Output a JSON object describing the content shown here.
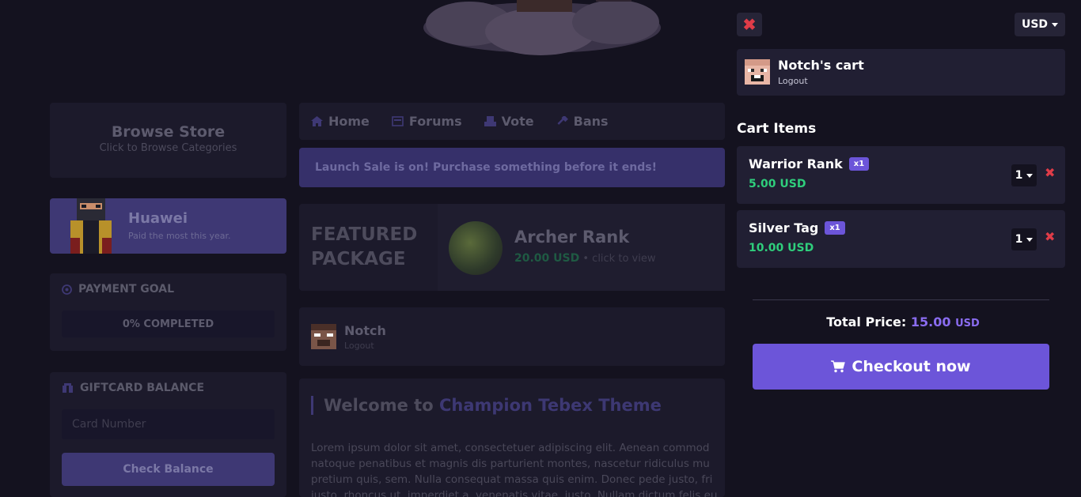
{
  "background": {
    "browse": {
      "title": "Browse Store",
      "subtitle": "Click to Browse Categories"
    },
    "top_donor": {
      "name": "Huawei",
      "subtitle": "Paid the most this year."
    },
    "payment_goal": {
      "title": "PAYMENT GOAL",
      "progress_label": "0% COMPLETED",
      "progress_percent": 0
    },
    "giftcard": {
      "title": "GIFTCARD BALANCE",
      "placeholder": "Card Number",
      "button": "Check Balance"
    },
    "nav": [
      {
        "label": "Home",
        "icon": "home-icon"
      },
      {
        "label": "Forums",
        "icon": "forums-icon"
      },
      {
        "label": "Vote",
        "icon": "vote-icon"
      },
      {
        "label": "Bans",
        "icon": "bans-icon"
      }
    ],
    "sale_banner": "Launch Sale is on! Purchase something before it ends!",
    "featured": {
      "label_line1": "FEATURED",
      "label_line2": "PACKAGE",
      "name": "Archer Rank",
      "price": "20.00 USD",
      "view_text": " • click to view"
    },
    "user": {
      "name": "Notch",
      "logout": "Logout"
    },
    "welcome": {
      "title_prefix": "Welcome to ",
      "title_accent": "Champion Tebex Theme",
      "lines": [
        "Lorem ipsum dolor sit amet, consectetuer adipiscing elit. Aenean commod",
        "natoque penatibus et magnis dis parturient montes, nascetur ridiculus mu",
        "pretium quis, sem. Nulla consequat massa quis enim. Donec pede justo, fri",
        "justo, rhoncus ut, imperdiet a, venenatis vitae, justo. Nullam dictum felis eu"
      ]
    }
  },
  "cart": {
    "currency": "USD",
    "user": {
      "name": "Notch's cart",
      "logout": "Logout"
    },
    "heading": "Cart Items",
    "items": [
      {
        "name": "Warrior Rank",
        "badge": "x1",
        "price": "5.00 USD",
        "quantity": "1"
      },
      {
        "name": "Silver Tag",
        "badge": "x1",
        "price": "10.00 USD",
        "quantity": "1"
      }
    ],
    "total_label": "Total Price:",
    "total_amount": "15.00",
    "total_currency": "USD",
    "checkout_label": "Checkout now"
  },
  "colors": {
    "accent": "#6c55d9",
    "price_green": "#2fce7c",
    "danger": "#e03c48",
    "panel": "#211f33"
  }
}
